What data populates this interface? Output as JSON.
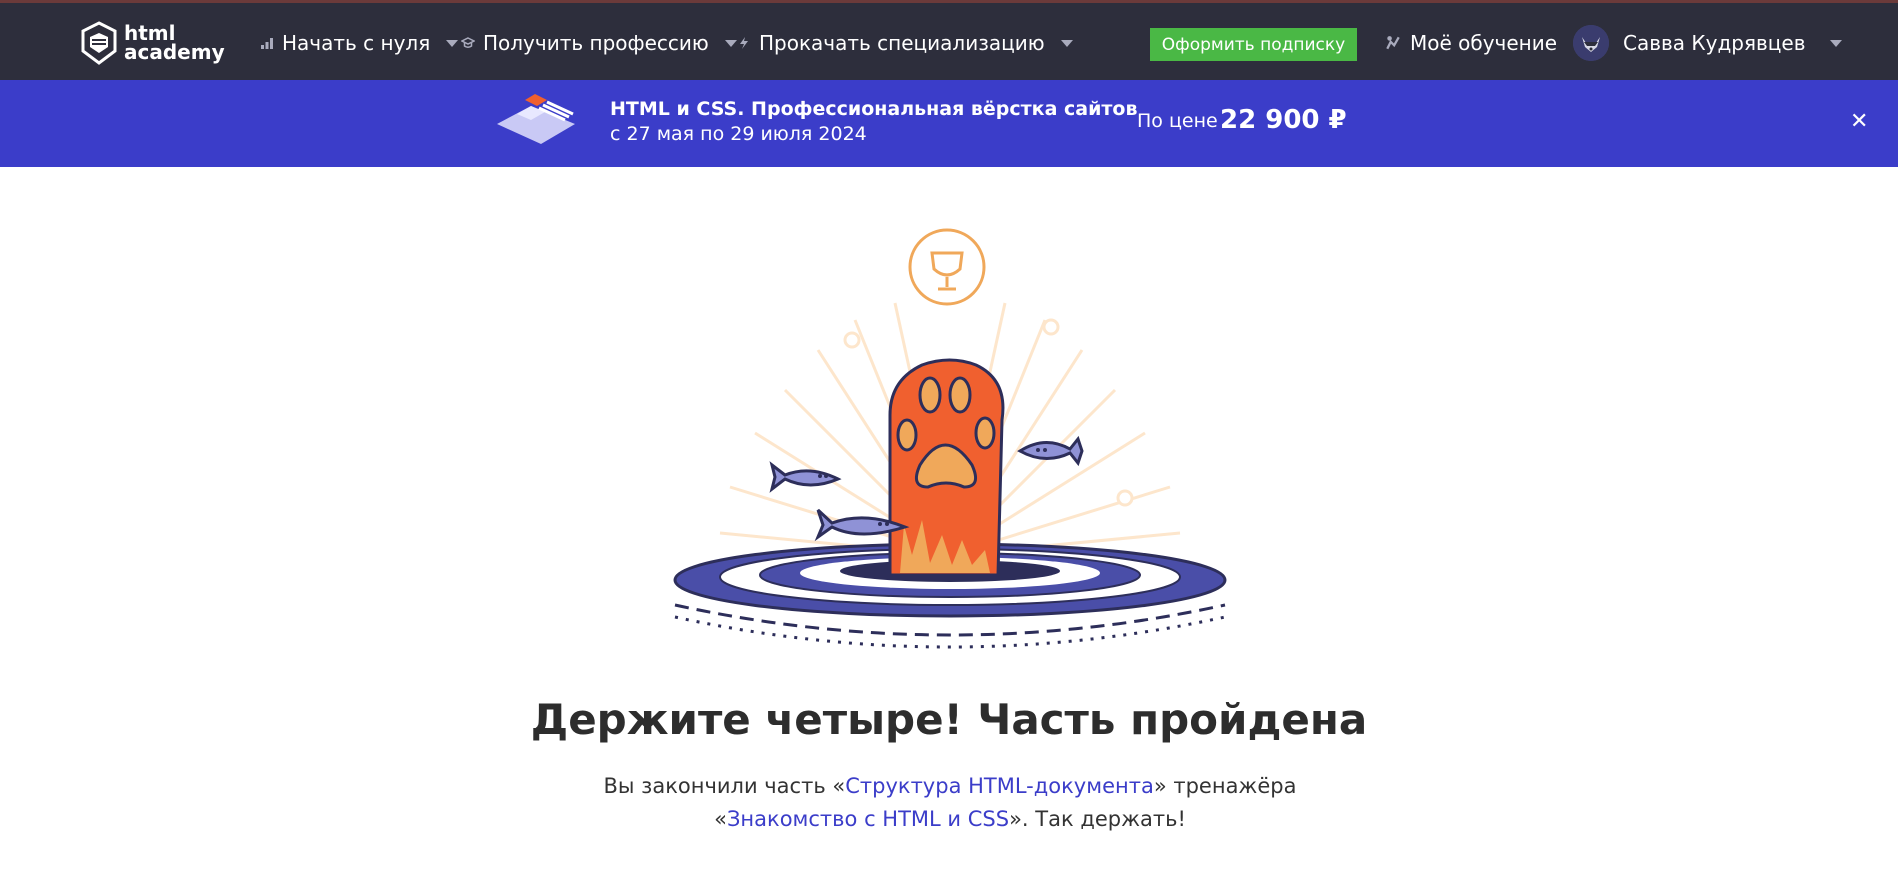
{
  "header": {
    "logo_line1": "html",
    "logo_line2": "academy",
    "nav": [
      {
        "label": "Начать с нуля",
        "icon": "bar-chart-icon"
      },
      {
        "label": "Получить профессию",
        "icon": "graduation-cap-icon"
      },
      {
        "label": "Прокачать специализацию",
        "icon": "lightning-icon"
      }
    ],
    "subscribe_label": "Оформить подписку",
    "my_learning_label": "Моё обучение",
    "user_name": "Савва Кудрявцев"
  },
  "promo": {
    "title": "HTML и CSS. Профессиональная вёрстка сайтов",
    "dates": "с 27 мая по 29 июля 2024",
    "price_label": "По цене",
    "price": "22 900 ₽",
    "close_glyph": "✕"
  },
  "result": {
    "headline": "Держите четыре! Часть пройдена",
    "text_before": "Вы закончили часть «",
    "part_link": "Структура HTML-документа",
    "text_middle": "» тренажёра «",
    "course_link": "Знакомство с HTML и CSS",
    "text_after": "». Так держать!"
  },
  "colors": {
    "topbar": "#2d2e3c",
    "promo": "#3b3dc9",
    "subscribe": "#4ab845",
    "link": "#3b3dc9",
    "paw": "#f0602f",
    "trophy": "#f0a85a"
  }
}
